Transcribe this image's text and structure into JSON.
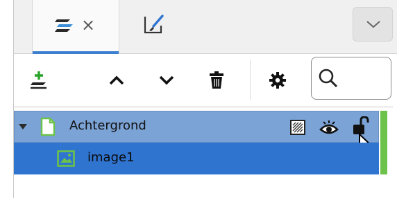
{
  "tabs": [
    {
      "name": "layers",
      "icon": "layers-icon",
      "active": true,
      "close_label": "×"
    },
    {
      "name": "brush",
      "icon": "brush-icon",
      "active": false
    }
  ],
  "tab_menu": {
    "icon": "chevron-down-icon"
  },
  "toolbar": {
    "buttons": [
      {
        "name": "add-layer",
        "icon": "add-layer-icon"
      },
      {
        "name": "move-up",
        "icon": "chevron-up-icon"
      },
      {
        "name": "move-down",
        "icon": "chevron-down-icon"
      },
      {
        "name": "delete",
        "icon": "trash-icon"
      },
      {
        "name": "settings",
        "icon": "gear-icon"
      }
    ],
    "search": {
      "icon": "search-icon",
      "value": "",
      "placeholder": ""
    }
  },
  "layers": [
    {
      "label": "Achtergrond",
      "type": "group",
      "expanded": true,
      "icon": "file-icon"
    },
    {
      "label": "image1",
      "type": "image",
      "icon": "image-icon"
    }
  ],
  "colors": {
    "accent": "#3c7fcf",
    "row_selected_parent": "#7ba3d6",
    "row_selected": "#2f74cf",
    "visibility_bar": "#6cc24a"
  }
}
